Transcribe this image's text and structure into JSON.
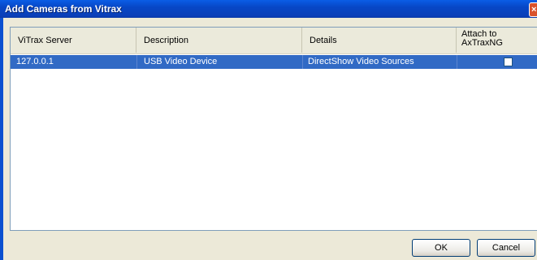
{
  "window": {
    "title": "Add Cameras from Vitrax"
  },
  "table": {
    "columns": [
      "ViTrax Server",
      "Description",
      "Details",
      "Attach to",
      "AxTraxNG"
    ],
    "rows": [
      {
        "server": "127.0.0.1",
        "description": "USB Video Device",
        "details": "DirectShow Video Sources",
        "attach": false
      }
    ]
  },
  "buttons": {
    "ok": "OK",
    "cancel": "Cancel"
  },
  "colors": {
    "titlebar": "#0a5de6",
    "selection": "#316ac5"
  }
}
